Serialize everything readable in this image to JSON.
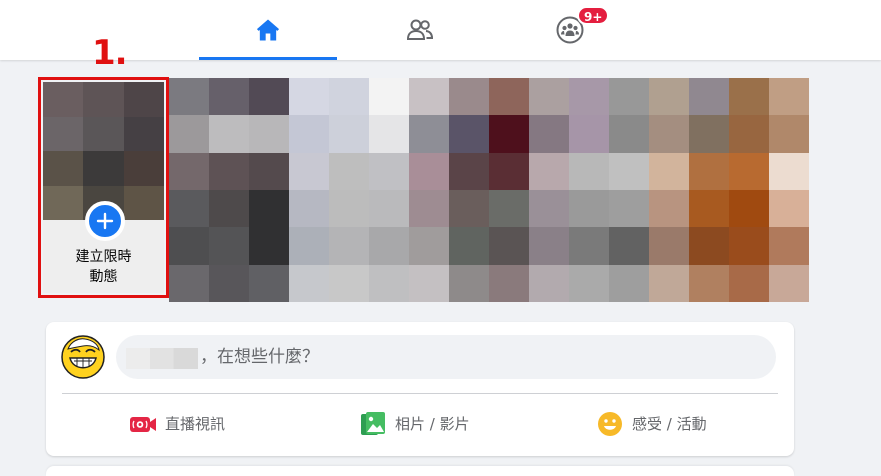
{
  "nav": {
    "tabs": [
      {
        "name": "home",
        "icon": "home-icon",
        "active": true
      },
      {
        "name": "friends",
        "icon": "friends-icon"
      },
      {
        "name": "groups",
        "icon": "groups-icon",
        "badge": "9+"
      }
    ],
    "accent_color": "#1877f2",
    "badge_color": "#e41e3f"
  },
  "annotation": {
    "label": "1.",
    "color": "#e01010"
  },
  "stories": {
    "create_label_line1": "建立限時",
    "create_label_line2": "動態",
    "create_icon": "plus-icon"
  },
  "composer": {
    "placeholder": "，在想些什麼？",
    "actions": [
      {
        "label": "直播視訊",
        "icon": "live-video-icon",
        "color": "#e42645"
      },
      {
        "label": "相片 / 影片",
        "icon": "photo-icon",
        "color": "#45bd62"
      },
      {
        "label": "感受 / 活動",
        "icon": "feeling-icon",
        "color": "#f7b928"
      }
    ]
  }
}
